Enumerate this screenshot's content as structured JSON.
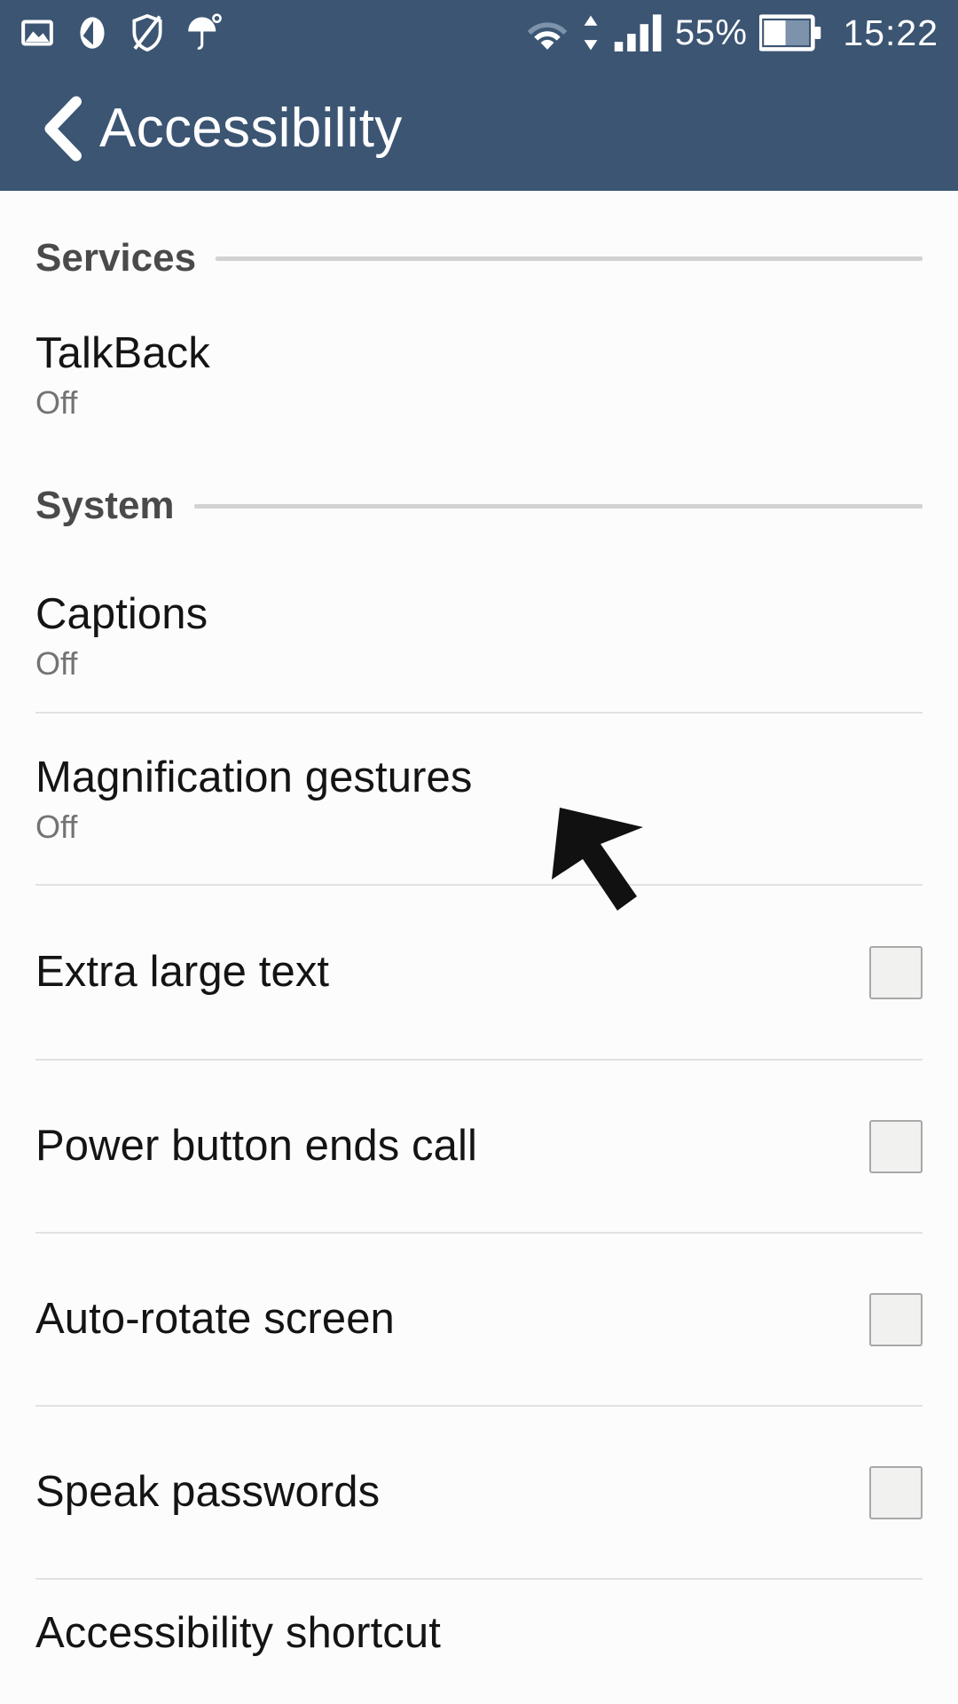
{
  "status_bar": {
    "left_icons": [
      {
        "name": "picture-icon",
        "label": "Screenshot"
      },
      {
        "name": "navigation-arrow-icon",
        "label": "Location"
      },
      {
        "name": "shield-off-icon",
        "label": "Protection off"
      },
      {
        "name": "umbrella-icon",
        "label": "Weather"
      }
    ],
    "right_icons": [
      {
        "name": "wifi-icon",
        "label": "Wi-Fi"
      },
      {
        "name": "data-transfer-icon",
        "label": "Data transfer"
      },
      {
        "name": "signal-bars-icon",
        "label": "Signal"
      },
      {
        "name": "battery-icon",
        "label": "Battery"
      }
    ],
    "battery_percent": "55%",
    "clock": "15:22"
  },
  "header": {
    "back_icon": "chevron-left-icon",
    "title": "Accessibility"
  },
  "colors": {
    "statusbar_bg": "#3b5573",
    "header_bg": "#3b5573",
    "page_bg": "#fcfcfc",
    "title_text": "#141414",
    "subtitle_text": "#737373",
    "section_text": "#4a4a4a",
    "divider": "#e2e2e2",
    "rule": "#d2d2d2",
    "checkbox_border": "#a8a8a8",
    "checkbox_fill": "#f1f1f0",
    "cursor": "#111111"
  },
  "sections": [
    {
      "id": "services",
      "label": "Services",
      "rows": [
        {
          "id": "talkback",
          "title": "TalkBack",
          "subtitle": "Off",
          "control": "none",
          "checked": false
        }
      ]
    },
    {
      "id": "system",
      "label": "System",
      "rows": [
        {
          "id": "captions",
          "title": "Captions",
          "subtitle": "Off",
          "control": "none",
          "checked": false
        },
        {
          "id": "magnification-gestures",
          "title": "Magnification gestures",
          "subtitle": "Off",
          "control": "none",
          "checked": false
        },
        {
          "id": "extra-large-text",
          "title": "Extra large text",
          "subtitle": "",
          "control": "checkbox",
          "checked": false
        },
        {
          "id": "power-button-ends-call",
          "title": "Power button ends call",
          "subtitle": "",
          "control": "checkbox",
          "checked": false
        },
        {
          "id": "auto-rotate-screen",
          "title": "Auto-rotate screen",
          "subtitle": "",
          "control": "checkbox",
          "checked": false
        },
        {
          "id": "speak-passwords",
          "title": "Speak passwords",
          "subtitle": "",
          "control": "checkbox",
          "checked": false
        },
        {
          "id": "accessibility-shortcut",
          "title": "Accessibility shortcut",
          "subtitle": "",
          "control": "none",
          "checked": false
        }
      ]
    }
  ],
  "cursor": {
    "name": "mouse-pointer-arrow",
    "direction": "up-left"
  }
}
